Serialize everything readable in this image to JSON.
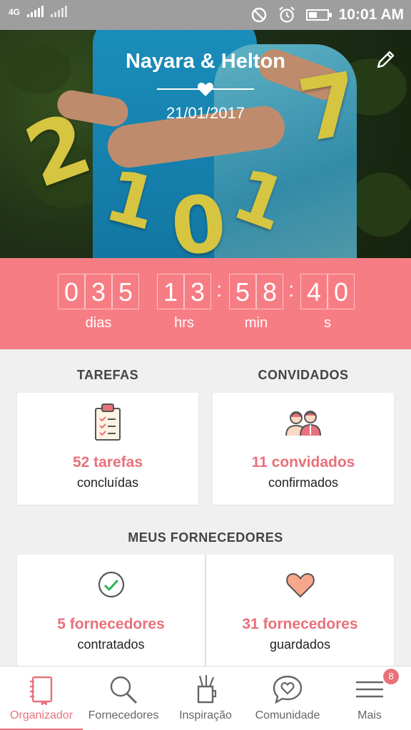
{
  "status_bar": {
    "network": "4G",
    "time": "10:01 AM",
    "icons": [
      "signal-icon",
      "do-not-disturb-icon",
      "alarm-icon",
      "battery-icon"
    ]
  },
  "header": {
    "couple_names": "Nayara & Helton",
    "wedding_date": "21/01/2017",
    "photo_numbers": [
      "2",
      "1",
      "0",
      "1",
      "7"
    ],
    "edit_icon": "pencil-icon"
  },
  "countdown": {
    "days": [
      "0",
      "3",
      "5"
    ],
    "hours": [
      "1",
      "3"
    ],
    "minutes": [
      "5",
      "8"
    ],
    "seconds": [
      "4",
      "0"
    ],
    "labels": {
      "days": "dias",
      "hours": "hrs",
      "minutes": "min",
      "seconds": "s"
    },
    "separator": ":"
  },
  "tarefas": {
    "title": "TAREFAS",
    "count": "52 tarefas",
    "sub": "concluídas",
    "icon": "clipboard-checklist-icon"
  },
  "convidados": {
    "title": "CONVIDADOS",
    "count": "11 convidados",
    "sub": "confirmados",
    "icon": "couple-guests-icon"
  },
  "fornecedores": {
    "title": "MEUS FORNECEDORES",
    "contratados": {
      "count": "5 fornecedores",
      "sub": "contratados",
      "icon": "check-circle-icon"
    },
    "guardados": {
      "count": "31 fornecedores",
      "sub": "guardados",
      "icon": "heart-icon"
    }
  },
  "nav": {
    "items": [
      {
        "label": "Organizador",
        "icon": "notebook-icon",
        "active": true
      },
      {
        "label": "Fornecedores",
        "icon": "search-icon",
        "active": false
      },
      {
        "label": "Inspiração",
        "icon": "pencil-cup-icon",
        "active": false
      },
      {
        "label": "Comunidade",
        "icon": "chat-heart-icon",
        "active": false
      },
      {
        "label": "Mais",
        "icon": "menu-icon",
        "active": false
      }
    ],
    "badge": "8"
  },
  "colors": {
    "accent": "#e8717b",
    "countdown_bg": "#f77d85",
    "photo_numbers": "#f4e14a",
    "status_bar": "#9e9e9e"
  }
}
